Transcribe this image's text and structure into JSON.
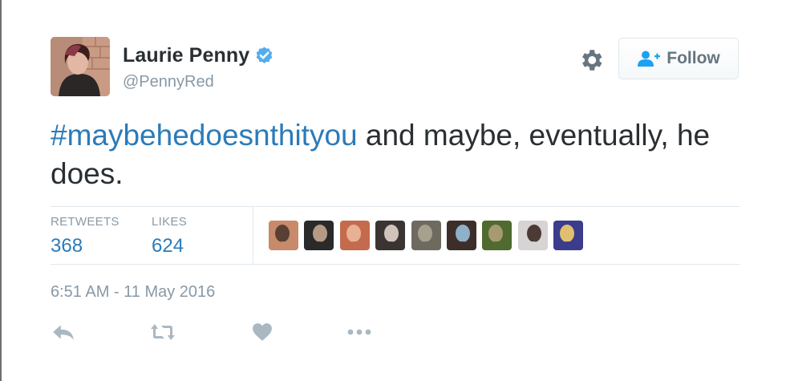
{
  "user": {
    "display_name": "Laurie Penny",
    "handle": "@PennyRed",
    "verified": true,
    "avatar_icon": "profile-photo"
  },
  "follow_button": {
    "label": "Follow",
    "icon": "add-user-icon"
  },
  "settings_icon": "gear-icon",
  "tweet": {
    "hashtag": "#maybehedoesnthityou",
    "text": " and maybe, eventually, he does."
  },
  "stats": {
    "retweets_label": "RETWEETS",
    "retweets_count": "368",
    "likes_label": "LIKES",
    "likes_count": "624"
  },
  "likers": [
    {
      "icon": "liker-avatar",
      "colors": [
        "#c78a6a",
        "#5a4034"
      ]
    },
    {
      "icon": "liker-avatar",
      "colors": [
        "#2a2a2a",
        "#b59a86"
      ]
    },
    {
      "icon": "liker-avatar",
      "colors": [
        "#c46b4e",
        "#e8b196"
      ]
    },
    {
      "icon": "liker-avatar",
      "colors": [
        "#3a3433",
        "#cfc3bb"
      ]
    },
    {
      "icon": "liker-avatar",
      "colors": [
        "#6f6a5f",
        "#a6a08f"
      ]
    },
    {
      "icon": "liker-avatar",
      "colors": [
        "#3e2e2a",
        "#8fb0c9"
      ]
    },
    {
      "icon": "liker-avatar",
      "colors": [
        "#4f6b2f",
        "#a79a73"
      ]
    },
    {
      "icon": "liker-avatar",
      "colors": [
        "#d7d4d3",
        "#4c3a36"
      ]
    },
    {
      "icon": "liker-avatar",
      "colors": [
        "#3c3c8c",
        "#e0c070"
      ]
    }
  ],
  "timestamp": "6:51 AM - 11 May 2016",
  "actions": {
    "reply_icon": "reply-icon",
    "retweet_icon": "retweet-icon",
    "like_icon": "heart-icon",
    "more_icon": "more-icon"
  },
  "colors": {
    "link": "#2b7bb9",
    "verified": "#55acee",
    "muted": "#8899a6",
    "text": "#292f33",
    "icon": "#aab8c2"
  }
}
